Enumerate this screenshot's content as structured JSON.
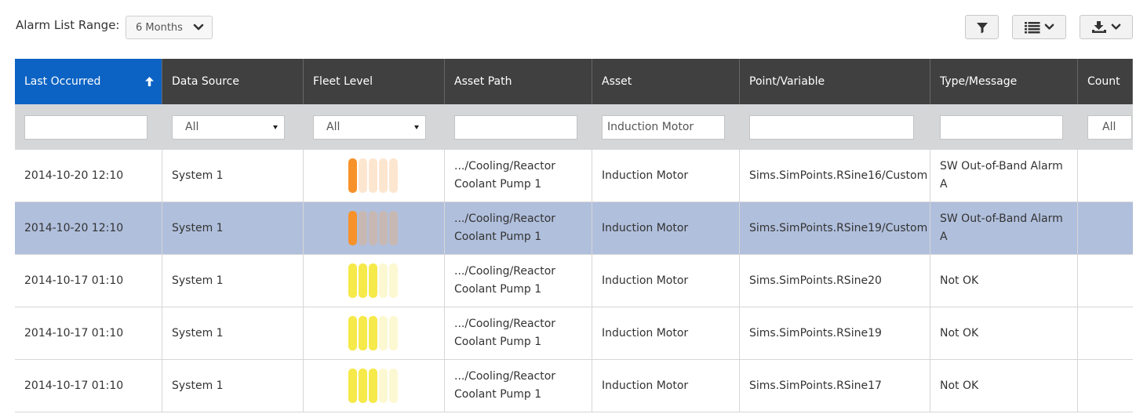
{
  "toolbar": {
    "range_label": "Alarm List Range:",
    "range_value": "6 Months"
  },
  "columns": [
    {
      "label": "Last Occurred",
      "sorted": "ascending"
    },
    {
      "label": "Data Source"
    },
    {
      "label": "Fleet Level"
    },
    {
      "label": "Asset Path"
    },
    {
      "label": "Asset"
    },
    {
      "label": "Point/Variable"
    },
    {
      "label": "Type/Message"
    },
    {
      "label": "Count"
    }
  ],
  "filters": {
    "last_occurred": "",
    "data_source": "All",
    "fleet_level": "All",
    "asset_path": "",
    "asset": "Induction Motor",
    "point_variable": "",
    "type_message": "",
    "count": "All"
  },
  "colors": {
    "header_bg": "#404040",
    "active_header_bg": "#0c63c4",
    "filter_bg": "#d4d6d8",
    "selected_row_bg": "#b0bfdc",
    "orange_active": "#f7922b",
    "orange_inactive": "#fde6d0",
    "orange_inactive_selected": "#c7b8b3",
    "yellow_active": "#f6e94a",
    "yellow_inactive": "#fcf8d2"
  },
  "rows": [
    {
      "last_occurred": "2014-10-20 12:10",
      "data_source": "System 1",
      "fleet_level": {
        "level": 1,
        "of": 5,
        "color": "orange"
      },
      "asset_path_1": ".../Cooling/Reactor",
      "asset_path_2": "Coolant Pump 1",
      "asset": "Induction Motor",
      "point_variable": "Sims.SimPoints.RSine16/Custom",
      "type_message_1": "SW Out-of-Band Alarm",
      "type_message_2": "A",
      "count": "",
      "selected": false
    },
    {
      "last_occurred": "2014-10-20 12:10",
      "data_source": "System 1",
      "fleet_level": {
        "level": 1,
        "of": 5,
        "color": "orange"
      },
      "asset_path_1": ".../Cooling/Reactor",
      "asset_path_2": "Coolant Pump 1",
      "asset": "Induction Motor",
      "point_variable": "Sims.SimPoints.RSine19/Custom",
      "type_message_1": "SW Out-of-Band Alarm",
      "type_message_2": "A",
      "count": "",
      "selected": true
    },
    {
      "last_occurred": "2014-10-17 01:10",
      "data_source": "System 1",
      "fleet_level": {
        "level": 3,
        "of": 5,
        "color": "yellow"
      },
      "asset_path_1": ".../Cooling/Reactor",
      "asset_path_2": "Coolant Pump 1",
      "asset": "Induction Motor",
      "point_variable": "Sims.SimPoints.RSine20",
      "type_message_1": "Not OK",
      "type_message_2": "",
      "count": "",
      "selected": false
    },
    {
      "last_occurred": "2014-10-17 01:10",
      "data_source": "System 1",
      "fleet_level": {
        "level": 3,
        "of": 5,
        "color": "yellow"
      },
      "asset_path_1": ".../Cooling/Reactor",
      "asset_path_2": "Coolant Pump 1",
      "asset": "Induction Motor",
      "point_variable": "Sims.SimPoints.RSine19",
      "type_message_1": "Not OK",
      "type_message_2": "",
      "count": "",
      "selected": false
    },
    {
      "last_occurred": "2014-10-17 01:10",
      "data_source": "System 1",
      "fleet_level": {
        "level": 3,
        "of": 5,
        "color": "yellow"
      },
      "asset_path_1": ".../Cooling/Reactor",
      "asset_path_2": "Coolant Pump 1",
      "asset": "Induction Motor",
      "point_variable": "Sims.SimPoints.RSine17",
      "type_message_1": "Not OK",
      "type_message_2": "",
      "count": "",
      "selected": false
    }
  ]
}
